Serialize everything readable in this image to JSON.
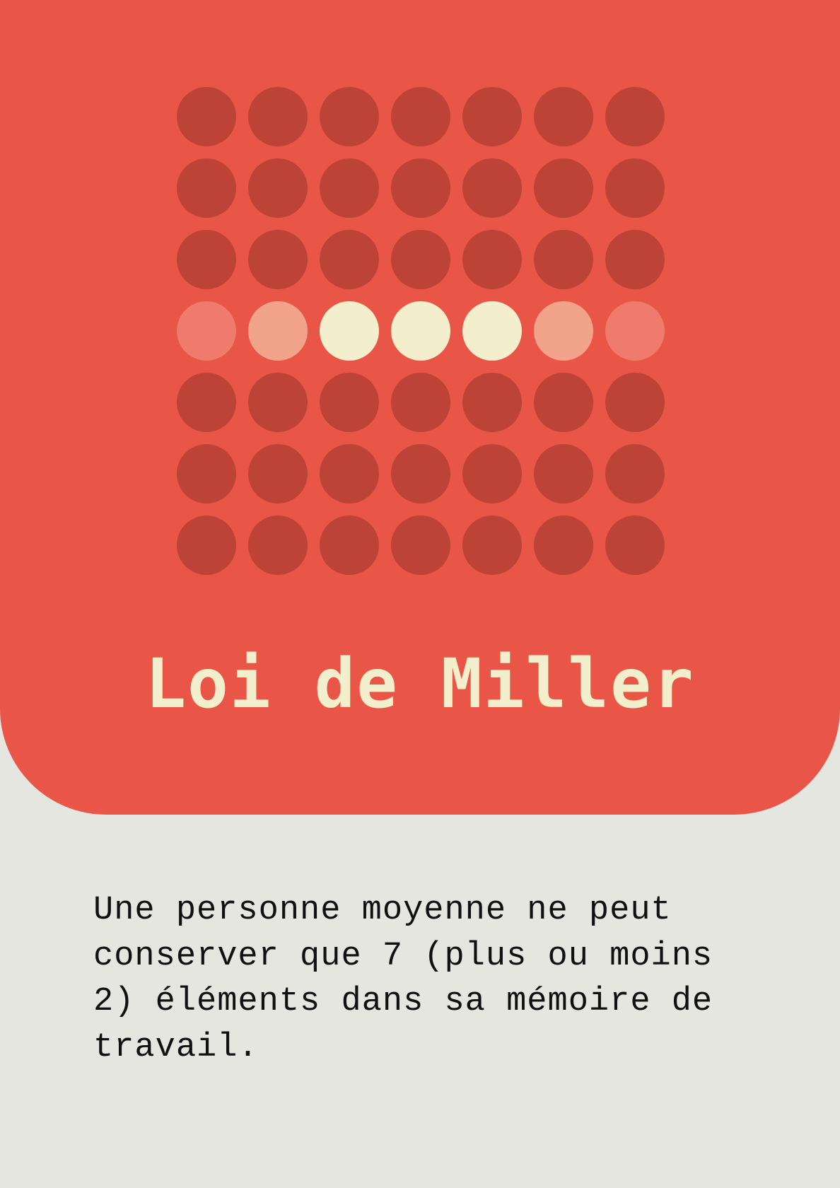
{
  "title": "Loi de Miller",
  "description": "Une personne moyenne ne peut conserver que 7 (plus ou moins 2) éléments dans sa mémoire de travail.",
  "colors": {
    "background": "#e5e6e0",
    "card": "#e95546",
    "accent_text": "#f3efcd",
    "body_text": "#111111"
  },
  "dot_grid": {
    "columns": 7,
    "rows": [
      [
        "dark",
        "dark",
        "dark",
        "dark",
        "dark",
        "dark",
        "dark"
      ],
      [
        "dark",
        "dark",
        "dark",
        "dark",
        "dark",
        "dark",
        "dark"
      ],
      [
        "dark",
        "dark",
        "dark",
        "dark",
        "dark",
        "dark",
        "dark"
      ],
      [
        "faint",
        "soft",
        "bright",
        "bright",
        "bright",
        "soft",
        "faint"
      ],
      [
        "dark",
        "dark",
        "dark",
        "dark",
        "dark",
        "dark",
        "dark"
      ],
      [
        "dark",
        "dark",
        "dark",
        "dark",
        "dark",
        "dark",
        "dark"
      ],
      [
        "dark",
        "dark",
        "dark",
        "dark",
        "dark",
        "dark",
        "dark"
      ]
    ],
    "colors": {
      "dark": "#bc4336",
      "faint": "#ee7b6b",
      "soft": "#f1a48a",
      "bright": "#f3efcd"
    }
  }
}
